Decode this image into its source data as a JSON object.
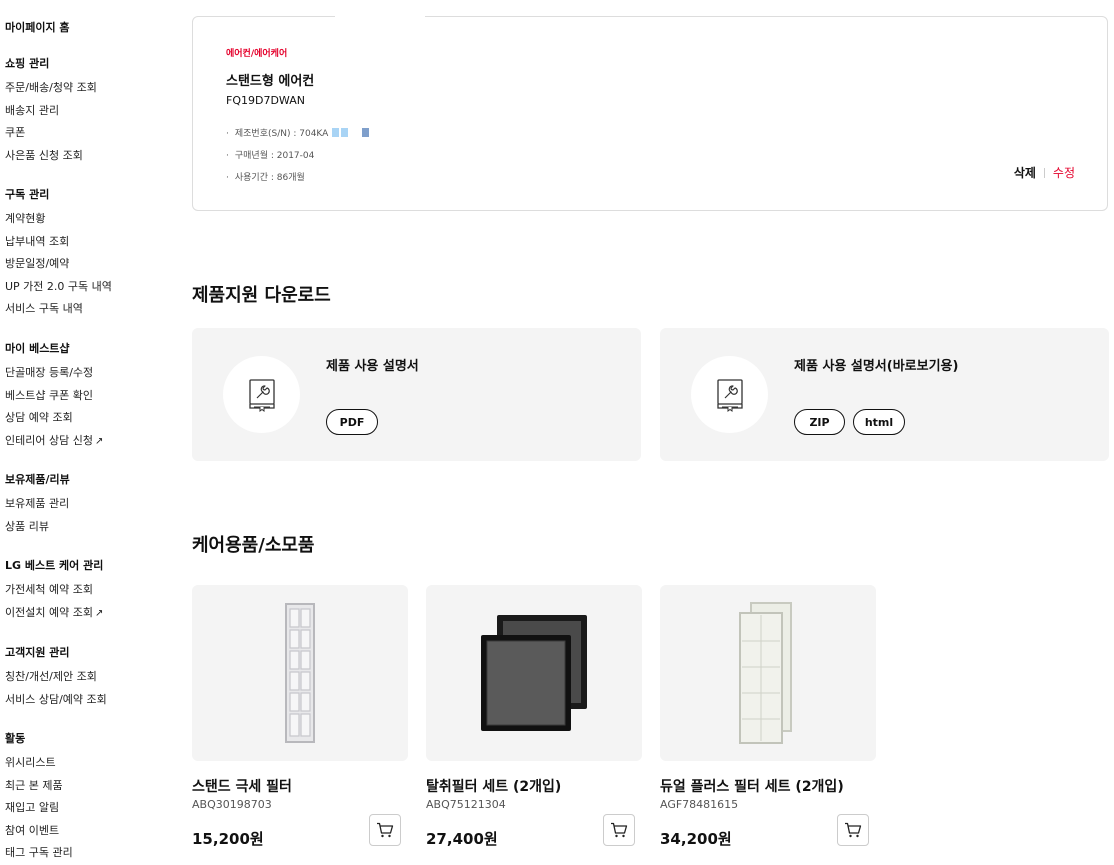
{
  "sidebar": {
    "home": "마이페이지 홈",
    "sections": [
      {
        "title": "쇼핑 관리",
        "items": [
          {
            "label": "주문/배송/청약 조회",
            "ext": ""
          },
          {
            "label": "배송지 관리",
            "ext": ""
          },
          {
            "label": "쿠폰",
            "ext": ""
          },
          {
            "label": "사은품 신청 조회",
            "ext": ""
          }
        ]
      },
      {
        "title": "구독 관리",
        "items": [
          {
            "label": "계약현황",
            "ext": ""
          },
          {
            "label": "납부내역 조회",
            "ext": ""
          },
          {
            "label": "방문일정/예약",
            "ext": ""
          },
          {
            "label": "UP 가전 2.0 구독 내역",
            "ext": ""
          },
          {
            "label": "서비스 구독 내역",
            "ext": ""
          }
        ]
      },
      {
        "title": "마이 베스트샵",
        "items": [
          {
            "label": "단골매장 등록/수정",
            "ext": ""
          },
          {
            "label": "베스트샵 쿠폰 확인",
            "ext": ""
          },
          {
            "label": "상담 예약 조회",
            "ext": ""
          },
          {
            "label": "인테리어 상담 신청",
            "ext": "↗"
          }
        ]
      },
      {
        "title": "보유제품/리뷰",
        "items": [
          {
            "label": "보유제품 관리",
            "ext": ""
          },
          {
            "label": "상품 리뷰",
            "ext": ""
          }
        ]
      },
      {
        "title": "LG 베스트 케어 관리",
        "items": [
          {
            "label": "가전세척 예약 조회",
            "ext": ""
          },
          {
            "label": "이전설치 예약 조회",
            "ext": "↗"
          }
        ]
      },
      {
        "title": "고객지원 관리",
        "items": [
          {
            "label": "칭찬/개선/제안 조회",
            "ext": ""
          },
          {
            "label": "서비스 상담/예약 조회",
            "ext": ""
          }
        ]
      },
      {
        "title": "활동",
        "items": [
          {
            "label": "위시리스트",
            "ext": ""
          },
          {
            "label": "최근 본 제품",
            "ext": ""
          },
          {
            "label": "재입고 알림",
            "ext": ""
          },
          {
            "label": "참여 이벤트",
            "ext": ""
          },
          {
            "label": "태그 구독 관리",
            "ext": ""
          }
        ]
      }
    ]
  },
  "product": {
    "category": "에어컨/에어케어",
    "name": "스탠드형 에어컨",
    "model": "FQ19D7DWAN",
    "specs": {
      "serial": "제조번호(S/N) : 704KA",
      "purchase": "구매년월 : 2017-04",
      "period": "사용기간 : 86개월"
    },
    "delete_label": "삭제",
    "edit_label": "수정"
  },
  "downloads": {
    "title": "제품지원 다운로드",
    "cards": [
      {
        "title": "제품 사용 설명서",
        "buttons": [
          "PDF"
        ]
      },
      {
        "title": "제품 사용 설명서(바로보기용)",
        "buttons": [
          "ZIP",
          "html"
        ]
      }
    ]
  },
  "care": {
    "title": "케어용품/소모품",
    "products": [
      {
        "name": "스탠드 극세 필터",
        "code": "ABQ30198703",
        "price": "15,200원"
      },
      {
        "name": "탈취필터 세트 (2개입)",
        "code": "ABQ75121304",
        "price": "27,400원"
      },
      {
        "name": "듀얼 플러스 필터 세트 (2개입)",
        "code": "AGF78481615",
        "price": "34,200원"
      }
    ]
  },
  "colors": {
    "accent": "#e4002b",
    "card_bg": "#f4f4f4",
    "mask_light": "#a9d4f5",
    "mask_dark": "#7f9fcb"
  }
}
